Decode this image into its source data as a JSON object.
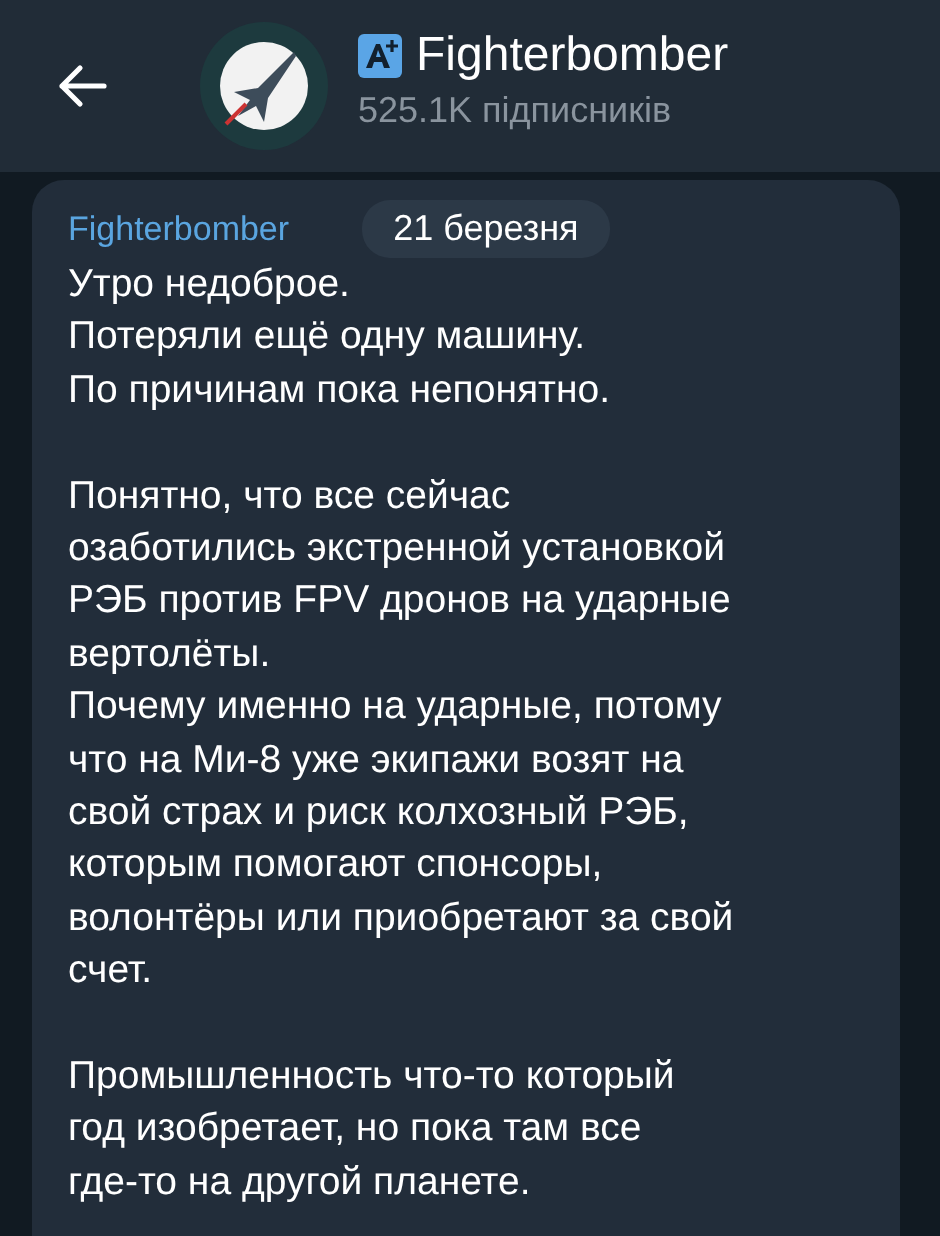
{
  "header": {
    "title": "Fighterbomber",
    "subtitle": "525.1K підписників"
  },
  "message": {
    "author": "Fighterbomber",
    "date": "21 березня",
    "paragraphs": [
      [
        "Утро недоброе.",
        "Потеряли ещё одну машину.",
        "По причинам пока непонятно."
      ],
      [
        "Понятно, что все сейчас",
        "озаботились экстренной установкой",
        "РЭБ против FPV дронов на ударные",
        "вертолёты.",
        "Почему именно на ударные, потому",
        "что на Ми-8 уже экипажи возят на",
        "свой страх и риск колхозный РЭБ,",
        "которым помогают спонсоры,",
        "волонтёры или приобретают за свой",
        "счет."
      ],
      [
        "Промышленность что-то который",
        "год изобретает, но пока там все",
        "где-то на другой планете."
      ]
    ]
  }
}
